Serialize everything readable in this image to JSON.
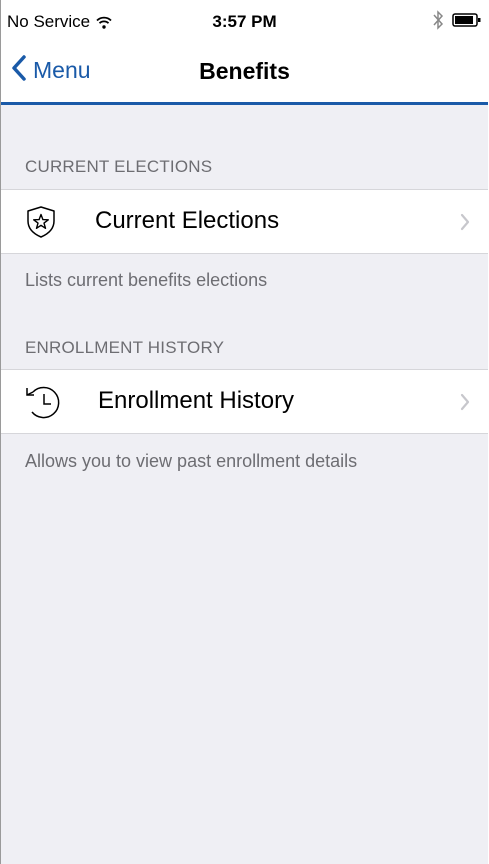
{
  "status_bar": {
    "carrier": "No Service",
    "time": "3:57 PM"
  },
  "nav": {
    "back_label": "Menu",
    "title": "Benefits"
  },
  "sections": [
    {
      "header": "CURRENT ELECTIONS",
      "cell_label": "Current Elections",
      "cell_icon": "shield-star-icon",
      "footer": "Lists current benefits elections"
    },
    {
      "header": "ENROLLMENT HISTORY",
      "cell_label": "Enrollment History",
      "cell_icon": "history-clock-icon",
      "footer": "Allows you to view past enrollment details"
    }
  ],
  "colors": {
    "accent": "#1a5aa8",
    "background": "#efeff4",
    "secondary_text": "#6d6d72"
  }
}
